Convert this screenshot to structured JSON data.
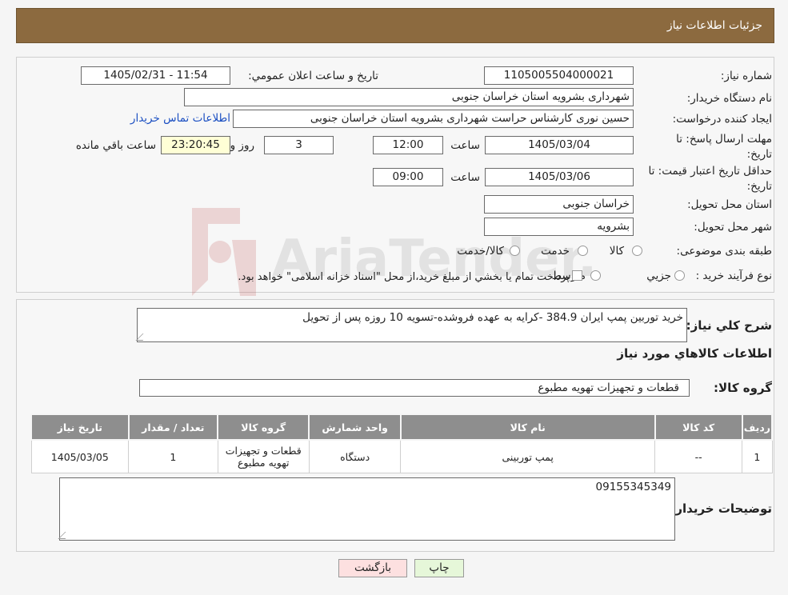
{
  "header": {
    "title": "جزئیات اطلاعات نیاز"
  },
  "watermark": {
    "text": "AriaTender.neT"
  },
  "form": {
    "need_number": {
      "label": "شماره نیاز:",
      "value": "1105005504000021"
    },
    "announce": {
      "label": "تاریخ و ساعت اعلان عمومي:",
      "value": "1405/02/31 - 11:54"
    },
    "buyer_org": {
      "label": "نام دستگاه خريدار:",
      "value": "شهرداری بشرویه استان خراسان جنوبی"
    },
    "requester": {
      "label": "ايجاد كننده درخواست:",
      "value": "حسین نوری کارشناس حراست شهرداری بشرویه استان خراسان جنوبی",
      "contact_link": "اطلاعات تماس خريدار"
    },
    "deadline": {
      "label": "مهلت ارسال پاسخ: تا تاريخ:",
      "date": "1405/03/04",
      "time_label": "ساعت",
      "time": "12:00",
      "days": "3",
      "days_label": "روز و",
      "remaining": "23:20:45",
      "remaining_label": "ساعت باقي مانده"
    },
    "validity": {
      "label": "حداقل تاريخ اعتبار قيمت: تا تاريخ:",
      "date": "1405/03/06",
      "time_label": "ساعت",
      "time": "09:00"
    },
    "province": {
      "label": "استان محل تحويل:",
      "value": "خراسان جنوبی"
    },
    "city": {
      "label": "شهر محل تحويل:",
      "value": "بشرویه"
    },
    "category": {
      "label": "طبقه بندی موضوعی:",
      "options": [
        "كالا",
        "خدمت",
        "كالا/خدمت"
      ]
    },
    "process": {
      "label": "نوع فرآيند خريد :",
      "options": [
        "جزيي",
        "متوسط"
      ],
      "note": "پرداخت تمام يا بخشي از مبلغ خريد،از محل \"اسناد خزانه اسلامی\" خواهد بود."
    }
  },
  "description": {
    "label": "شرح كلي نياز:",
    "value": "خرید توربین پمپ ایران 384.9 -کرایه به عهده فروشده-تسویه 10 روزه پس از تحویل"
  },
  "goods_info": {
    "title": "اطلاعات كالاهاي مورد نياز"
  },
  "goods_group": {
    "label": "گروه كالا:",
    "value": "قطعات و تجهیزات تهویه مطبوع"
  },
  "table": {
    "headers": [
      "رديف",
      "كد كالا",
      "نام كالا",
      "واحد شمارش",
      "گروه كالا",
      "تعداد / مقدار",
      "تاريخ نياز"
    ],
    "rows": [
      [
        "1",
        "--",
        "پمپ توربینی",
        "دستگاه",
        "قطعات و تجهیزات تهویه مطبوع",
        "1",
        "1405/03/05"
      ]
    ]
  },
  "buyer_notes": {
    "label": "توضيحات خريدار:",
    "value": "09155345349"
  },
  "buttons": {
    "print": "چاپ",
    "back": "بازگشت"
  },
  "colors": {
    "header": "#8c6a3f",
    "table_header": "#8e8e8e",
    "print_btn": "#e6f7d9",
    "back_btn": "#fde0e0"
  }
}
